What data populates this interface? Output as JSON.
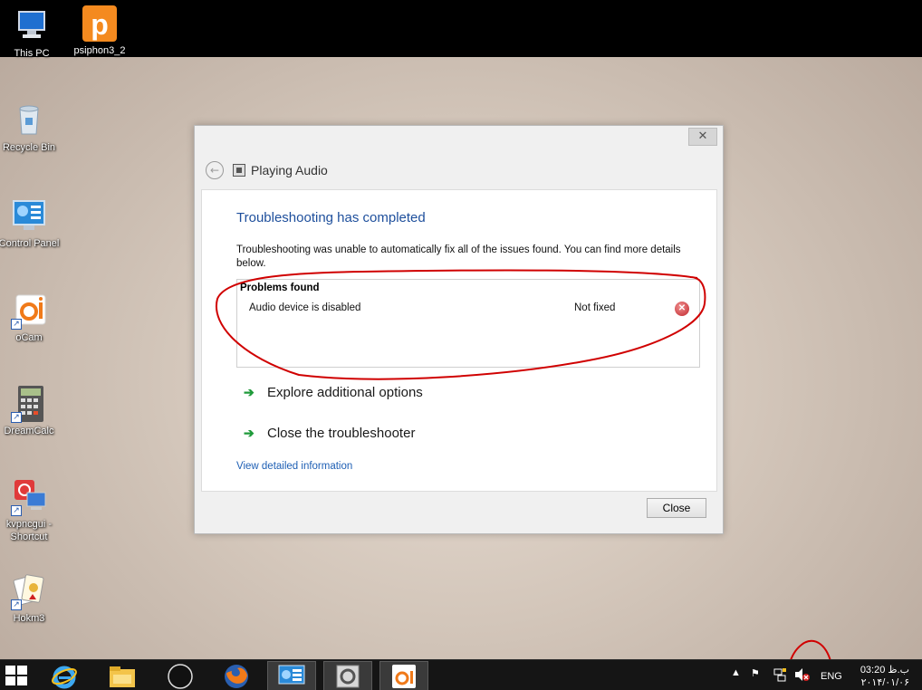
{
  "desktop": {
    "icons": [
      {
        "label": "This PC"
      },
      {
        "label": "psiphon3_2"
      },
      {
        "label": "Recycle Bin"
      },
      {
        "label": "Control Panel"
      },
      {
        "label": "oCam"
      },
      {
        "label": "DreamCalc"
      },
      {
        "label": "kvpncgui - Shortcut"
      },
      {
        "label": "Hokm3"
      }
    ]
  },
  "dialog": {
    "window_title": "Playing Audio",
    "close_glyph": "✕",
    "heading": "Troubleshooting has completed",
    "description": "Troubleshooting was unable to automatically fix all of the issues found. You can find more details below.",
    "problems": {
      "header": "Problems found",
      "rows": [
        {
          "name": "Audio device is disabled",
          "status": "Not fixed",
          "status_icon": "error-icon"
        }
      ]
    },
    "actions": [
      {
        "label": "Explore additional options"
      },
      {
        "label": "Close the troubleshooter"
      }
    ],
    "detail_link": "View detailed information",
    "close_button": "Close"
  },
  "taskbar": {
    "tray": {
      "language": "ENG",
      "time": "03:20 ب.ظ",
      "date": "۲۰۱۴/۰۱/۰۶"
    }
  },
  "colors": {
    "heading": "#1e4f9c",
    "link": "#1e5fb4",
    "arrow": "#1f9a3a",
    "annotation": "#d00000"
  }
}
